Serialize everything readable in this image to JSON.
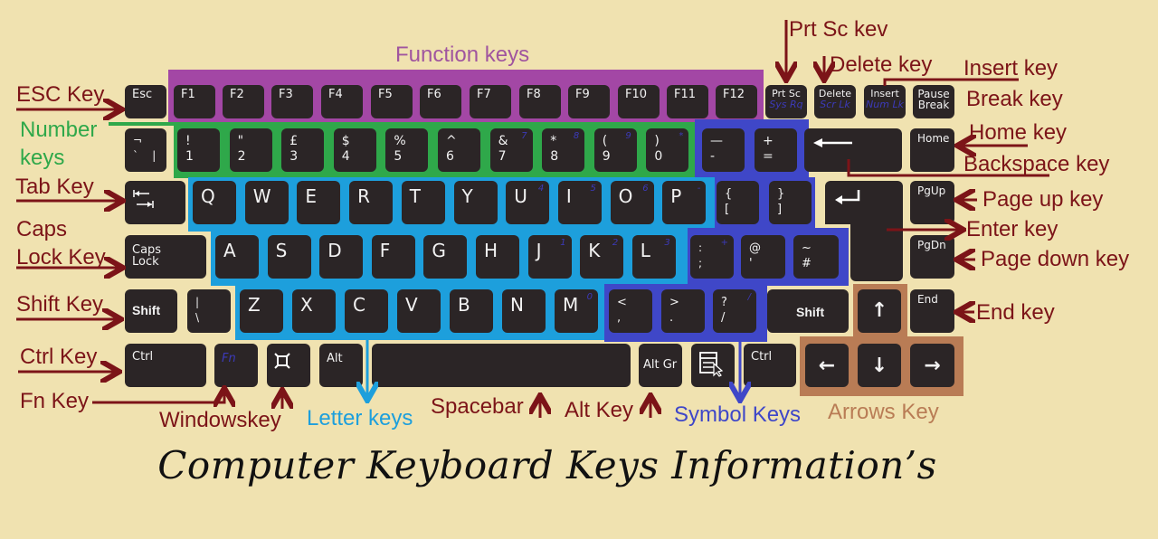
{
  "title": "Computer Keyboard Keys Information’s",
  "colors": {
    "background": "#f0e2b0",
    "key": "#2b2526",
    "label": "#7c1418",
    "function_zone": "#a347a5",
    "number_zone": "#2fa84a",
    "letter_zone": "#1d9fdc",
    "symbol_zone": "#3f47c8",
    "arrow_zone": "#b97c55",
    "alt_legend": "#3c3ab8"
  },
  "zone_labels": {
    "function": "Function keys",
    "number": "Number keys",
    "letter": "Letter keys",
    "symbol": "Symbol Keys",
    "arrows": "Arrows Key"
  },
  "callouts": {
    "esc": "ESC Key",
    "tab": "Tab Key",
    "caps": "Caps Lock Key",
    "shift": "Shift Key",
    "ctrl": "Ctrl Key",
    "fn": "Fn Key",
    "windows": "Windowskey",
    "spacebar": "Spacebar",
    "alt": "Alt Key",
    "prtsc": "Prt Sc kev",
    "delete": "Delete key",
    "insert": "Insert key",
    "break": "Break key",
    "home": "Home key",
    "backspace": "Backspace key",
    "pageup": "Page up key",
    "enter": "Enter key",
    "pagedown": "Page down key",
    "end": "End key"
  },
  "keys": {
    "esc": "Esc",
    "f": [
      "F1",
      "F2",
      "F3",
      "F4",
      "F5",
      "F6",
      "F7",
      "F8",
      "F9",
      "F10",
      "F11",
      "F12"
    ],
    "prtsc": {
      "main": "Prt Sc",
      "alt": "Sys Rq"
    },
    "delete": {
      "main": "Delete",
      "alt": "Scr Lk"
    },
    "insert": {
      "main": "Insert",
      "alt": "Num Lk"
    },
    "pause": "Pause\nBreak",
    "backtick": "¬     \n`    |",
    "numbers": [
      {
        "top": "!",
        "bottom": "1",
        "alt": ""
      },
      {
        "top": "\"",
        "bottom": "2",
        "alt": ""
      },
      {
        "top": "£",
        "bottom": "3",
        "alt": ""
      },
      {
        "top": "$",
        "bottom": "4",
        "alt": ""
      },
      {
        "top": "%",
        "bottom": "5",
        "alt": ""
      },
      {
        "top": "^",
        "bottom": "6",
        "alt": ""
      },
      {
        "top": "&",
        "bottom": "7",
        "alt": "7"
      },
      {
        "top": "*",
        "bottom": "8",
        "alt": "8"
      },
      {
        "top": "(",
        "bottom": "9",
        "alt": "9"
      },
      {
        "top": ")",
        "bottom": "0",
        "alt": "*"
      }
    ],
    "minus": {
      "top": "—",
      "bottom": "-"
    },
    "equals": {
      "top": "+",
      "bottom": "="
    },
    "home": "Home",
    "row_q": [
      {
        "k": "Q",
        "alt": ""
      },
      {
        "k": "W",
        "alt": ""
      },
      {
        "k": "E",
        "alt": ""
      },
      {
        "k": "R",
        "alt": ""
      },
      {
        "k": "T",
        "alt": ""
      },
      {
        "k": "Y",
        "alt": ""
      },
      {
        "k": "U",
        "alt": "4"
      },
      {
        "k": "I",
        "alt": "5"
      },
      {
        "k": "O",
        "alt": "6"
      },
      {
        "k": "P",
        "alt": "-"
      }
    ],
    "brace_open": {
      "top": "{",
      "bottom": "["
    },
    "brace_close": {
      "top": "}",
      "bottom": "]"
    },
    "pgup": "PgUp",
    "caps": "Caps\nLock",
    "row_a": [
      {
        "k": "A",
        "alt": ""
      },
      {
        "k": "S",
        "alt": ""
      },
      {
        "k": "D",
        "alt": ""
      },
      {
        "k": "F",
        "alt": ""
      },
      {
        "k": "G",
        "alt": ""
      },
      {
        "k": "H",
        "alt": ""
      },
      {
        "k": "J",
        "alt": "1"
      },
      {
        "k": "K",
        "alt": "2"
      },
      {
        "k": "L",
        "alt": "3"
      }
    ],
    "semicolon": {
      "top": ":",
      "bottom": ";",
      "alt": "+"
    },
    "quote": {
      "top": "@",
      "bottom": "'"
    },
    "hash": {
      "top": "~",
      "bottom": "#"
    },
    "pgdn": "PgDn",
    "shift": "Shift",
    "backslash": {
      "top": "|",
      "bottom": "\\"
    },
    "row_z": [
      {
        "k": "Z",
        "alt": ""
      },
      {
        "k": "X",
        "alt": ""
      },
      {
        "k": "C",
        "alt": ""
      },
      {
        "k": "V",
        "alt": ""
      },
      {
        "k": "B",
        "alt": ""
      },
      {
        "k": "N",
        "alt": ""
      },
      {
        "k": "M",
        "alt": "0"
      }
    ],
    "comma": {
      "top": "<",
      "bottom": ","
    },
    "period": {
      "top": ">",
      "bottom": "."
    },
    "slash": {
      "top": "?",
      "bottom": "/",
      "alt": "/"
    },
    "end": "End",
    "ctrl": "Ctrl",
    "fn": "Fn",
    "alt": "Alt",
    "altgr": "Alt Gr",
    "arrow_up": "↑",
    "arrow_left": "←",
    "arrow_down": "↓",
    "arrow_right": "→"
  }
}
